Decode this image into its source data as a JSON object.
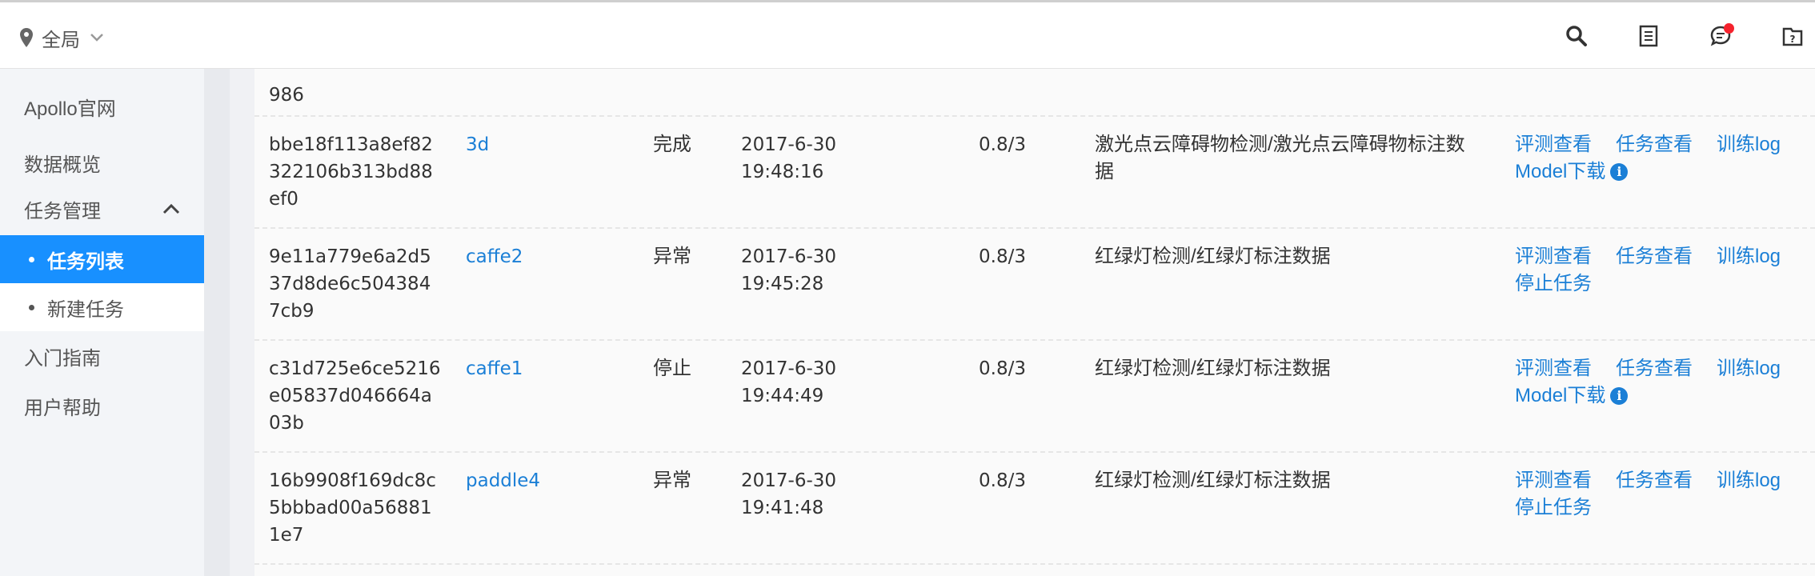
{
  "topbar": {
    "region_label": "全局",
    "icons": [
      "search-icon",
      "document-list-icon",
      "message-icon",
      "help-icon"
    ],
    "notification_color": "#f5222d"
  },
  "sidebar": {
    "items": [
      {
        "label": "Apollo官网"
      },
      {
        "label": "数据概览"
      },
      {
        "label": "任务管理"
      },
      {
        "label": "任务列表",
        "active": true
      },
      {
        "label": "新建任务"
      },
      {
        "label": "入门指南"
      },
      {
        "label": "用户帮助"
      }
    ],
    "active_color": "#1890ff"
  },
  "table": {
    "partial_top_row": {
      "id_tail": "986"
    },
    "rows": [
      {
        "id": "bbe18f113a8ef82322106b313bd88ef0",
        "name": "3d",
        "status": "完成",
        "date": "2017-6-30",
        "time": "19:48:16",
        "ratio": "0.8/3",
        "desc": "激光点云障碍物检测/激光点云障碍物标注数据",
        "ops": {
          "eval": "评测查看",
          "task": "任务查看",
          "log": "训练log",
          "extra": "Model下载",
          "has_info": true
        }
      },
      {
        "id": "9e11a779e6a2d537d8de6c5043847cb9",
        "name": "caffe2",
        "status": "异常",
        "date": "2017-6-30",
        "time": "19:45:28",
        "ratio": "0.8/3",
        "desc": "红绿灯检测/红绿灯标注数据",
        "ops": {
          "eval": "评测查看",
          "task": "任务查看",
          "log": "训练log",
          "extra": "停止任务",
          "has_info": false
        }
      },
      {
        "id": "c31d725e6ce5216e05837d046664a03b",
        "name": "caffe1",
        "status": "停止",
        "date": "2017-6-30",
        "time": "19:44:49",
        "ratio": "0.8/3",
        "desc": "红绿灯检测/红绿灯标注数据",
        "ops": {
          "eval": "评测查看",
          "task": "任务查看",
          "log": "训练log",
          "extra": "Model下载",
          "has_info": true
        }
      },
      {
        "id": "16b9908f169dc8c5bbbad00a568811e7",
        "name": "paddle4",
        "status": "异常",
        "date": "2017-6-30",
        "time": "19:41:48",
        "ratio": "0.8/3",
        "desc": "红绿灯检测/红绿灯标注数据",
        "ops": {
          "eval": "评测查看",
          "task": "任务查看",
          "log": "训练log",
          "extra": "停止任务",
          "has_info": false
        }
      }
    ],
    "link_color": "#1b7fd6"
  }
}
